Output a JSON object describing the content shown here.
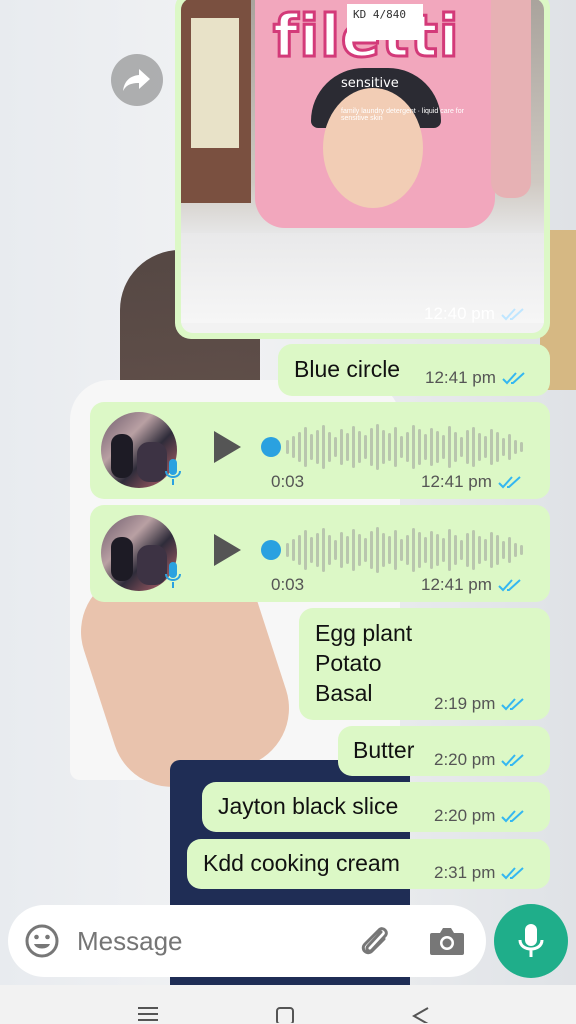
{
  "image_message": {
    "brand_text": "filetti",
    "price_tag_text": "KD 4/840",
    "cap_label": "sensitive",
    "detergent_text": "family laundry detergent · liquid care for sensitive skin",
    "time": "12:40 pm"
  },
  "messages": [
    {
      "type": "text",
      "text": "Blue circle",
      "time": "12:41 pm",
      "status": "read"
    },
    {
      "type": "voice",
      "duration": "0:03",
      "time": "12:41 pm",
      "status": "read",
      "progress": 0.0
    },
    {
      "type": "voice",
      "duration": "0:03",
      "time": "12:41 pm",
      "status": "read",
      "progress": 0.0
    },
    {
      "type": "text",
      "text": "Egg plant\nPotato\nBasal",
      "time": "2:19 pm",
      "status": "read"
    },
    {
      "type": "text",
      "text": "Butter",
      "time": "2:20 pm",
      "status": "read"
    },
    {
      "type": "text",
      "text": "Jayton black slice",
      "time": "2:20 pm",
      "status": "read"
    },
    {
      "type": "text",
      "text": "Kdd cooking cream",
      "time": "2:31 pm",
      "status": "read"
    }
  ],
  "composer": {
    "placeholder": "Message",
    "icons": [
      "emoji-icon",
      "attach-icon",
      "camera-icon",
      "mic-icon"
    ]
  },
  "colors": {
    "bubble_outgoing": "#dcf8c6",
    "read_ticks": "#34b7f1",
    "mic_button": "#1fae8a",
    "voice_dot": "#2aa1e0"
  },
  "navigation": [
    "menu-icon",
    "home-icon",
    "back-icon"
  ]
}
